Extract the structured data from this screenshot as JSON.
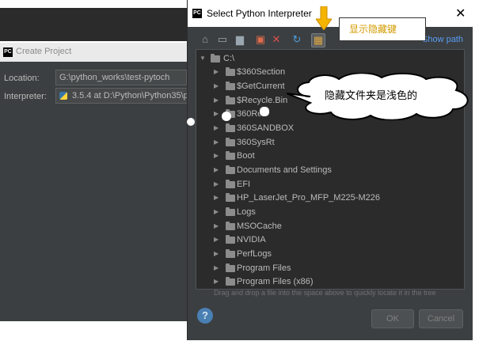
{
  "create_project": {
    "title": "Create Project",
    "location_label": "Location:",
    "location_value": "G:\\python_works\\test-pytoch",
    "interpreter_label": "Interpreter:",
    "interpreter_value": "3.5.4 at D:\\Python\\Python35\\p"
  },
  "dialog": {
    "title": "Select Python Interpreter",
    "close": "✕",
    "show_path": "Show path",
    "hint": "Drag and drop a file into the space above to quickly locate it in the tree",
    "help": "?",
    "ok_label": "OK",
    "cancel_label": "Cancel"
  },
  "toolbar": {
    "icons": [
      "home-icon",
      "desktop-icon",
      "project-icon",
      "new-folder-icon",
      "delete-icon",
      "refresh-icon",
      "show-hidden-icon"
    ]
  },
  "tree": {
    "root": "C:\\",
    "items": [
      "$360Section",
      "$GetCurrent",
      "$Recycle.Bin",
      "360Re",
      "360SANDBOX",
      "360SysRt",
      "Boot",
      "Documents and Settings",
      "EFI",
      "HP_LaserJet_Pro_MFP_M225-M226",
      "Logs",
      "MSOCache",
      "NVIDIA",
      "PerfLogs",
      "Program Files",
      "Program Files (x86)"
    ]
  },
  "annotations": {
    "show_hidden": "显示隐藏键",
    "hidden_light": "隐藏文件夹是浅色的"
  },
  "colors": {
    "dialog_bg": "#3c3f41",
    "tree_bg": "#2b2b2b",
    "annotation_text": "#d39b00",
    "link": "#589df6"
  }
}
